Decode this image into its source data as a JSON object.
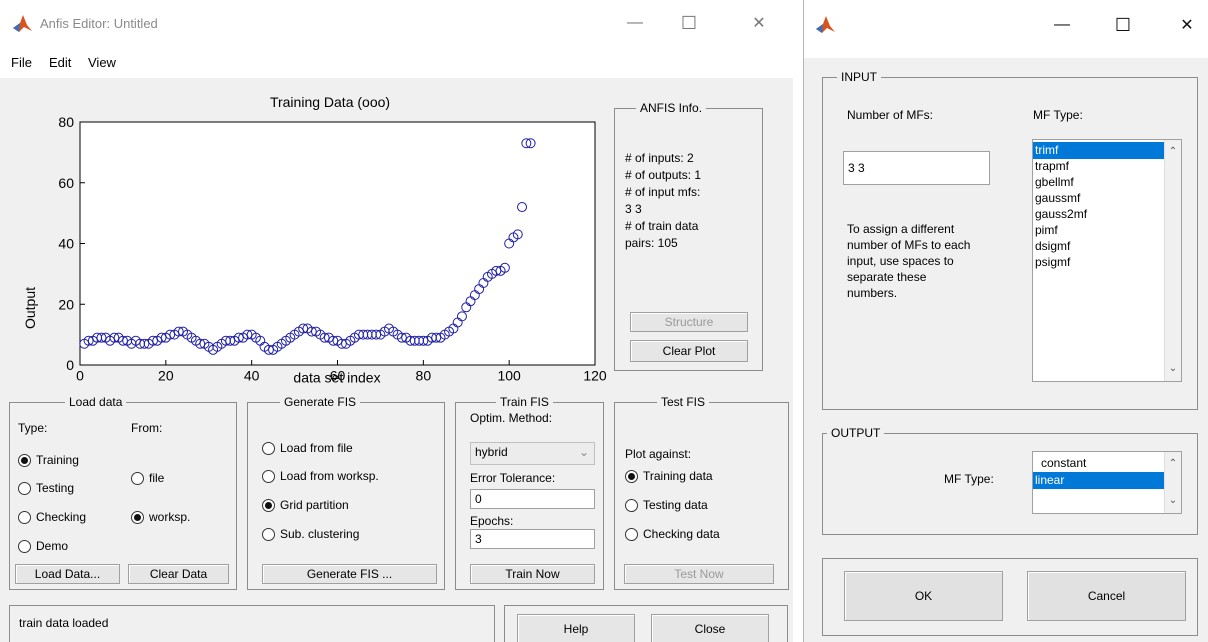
{
  "anfis": {
    "title": "Anfis Editor: Untitled",
    "menu": [
      "File",
      "Edit",
      "View"
    ],
    "plot": {
      "title": "Training Data (ooo)",
      "xlabel": "data set index",
      "ylabel": "Output",
      "xticks": [
        "0",
        "20",
        "40",
        "60",
        "80",
        "100",
        "120"
      ],
      "yticks": [
        "0",
        "20",
        "40",
        "60",
        "80"
      ]
    },
    "info": {
      "title": "ANFIS Info.",
      "lines": [
        "# of inputs: 2",
        "# of outputs: 1",
        "# of input mfs:",
        "3  3",
        "# of train data",
        "pairs: 105"
      ],
      "structure_label": "Structure",
      "clear_plot_label": "Clear Plot"
    },
    "load_data": {
      "title": "Load data",
      "type_label": "Type:",
      "from_label": "From:",
      "types": [
        "Training",
        "Testing",
        "Checking",
        "Demo"
      ],
      "selected_type": "Training",
      "sources": [
        "file",
        "worksp."
      ],
      "selected_source": "worksp.",
      "load_button": "Load Data...",
      "clear_button": "Clear Data"
    },
    "generate_fis": {
      "title": "Generate FIS",
      "options": [
        "Load from file",
        "Load from worksp.",
        "Grid partition",
        "Sub. clustering"
      ],
      "selected": "Grid partition",
      "button": "Generate FIS ..."
    },
    "train_fis": {
      "title": "Train FIS",
      "method_label": "Optim. Method:",
      "method": "hybrid",
      "tolerance_label": "Error Tolerance:",
      "tolerance": "0",
      "epochs_label": "Epochs:",
      "epochs": "3",
      "button": "Train Now"
    },
    "test_fis": {
      "title": "Test FIS",
      "plot_against_label": "Plot against:",
      "options": [
        "Training data",
        "Testing data",
        "Checking data"
      ],
      "selected": "Training data",
      "button": "Test Now"
    },
    "status": "train data loaded",
    "help_label": "Help",
    "close_label": "Close"
  },
  "mf_dialog": {
    "input": {
      "title": "INPUT",
      "num_label": "Number of MFs:",
      "num_value": "3 3",
      "type_label": "MF Type:",
      "hint": [
        "To assign a different",
        "number of MFs to each",
        "input, use spaces to",
        "separate these",
        "numbers."
      ],
      "types": [
        "trimf",
        "trapmf",
        "gbellmf",
        "gaussmf",
        "gauss2mf",
        "pimf",
        "dsigmf",
        "psigmf"
      ],
      "selected": "trimf"
    },
    "output": {
      "title": "OUTPUT",
      "type_label": "MF Type:",
      "types": [
        "constant",
        "linear"
      ],
      "selected": "linear"
    },
    "ok_label": "OK",
    "cancel_label": "Cancel"
  },
  "colors": {
    "marker": "#1f1fa6",
    "selection": "#0078d7",
    "window_bg": "#f0f0f0",
    "app_icon": "#d9531e"
  },
  "chart_data": {
    "type": "scatter",
    "title": "Training Data (ooo)",
    "xlabel": "data set index",
    "ylabel": "Output",
    "xlim": [
      0,
      120
    ],
    "ylim": [
      0,
      80
    ],
    "marker": "circle",
    "x": [
      1,
      2,
      3,
      4,
      5,
      6,
      7,
      8,
      9,
      10,
      11,
      12,
      13,
      14,
      15,
      16,
      17,
      18,
      19,
      20,
      21,
      22,
      23,
      24,
      25,
      26,
      27,
      28,
      29,
      30,
      31,
      32,
      33,
      34,
      35,
      36,
      37,
      38,
      39,
      40,
      41,
      42,
      43,
      44,
      45,
      46,
      47,
      48,
      49,
      50,
      51,
      52,
      53,
      54,
      55,
      56,
      57,
      58,
      59,
      60,
      61,
      62,
      63,
      64,
      65,
      66,
      67,
      68,
      69,
      70,
      71,
      72,
      73,
      74,
      75,
      76,
      77,
      78,
      79,
      80,
      81,
      82,
      83,
      84,
      85,
      86,
      87,
      88,
      89,
      90,
      91,
      92,
      93,
      94,
      95,
      96,
      97,
      98,
      99,
      100,
      101,
      102,
      103,
      104,
      105
    ],
    "y": [
      7,
      8,
      8,
      9,
      9,
      9,
      8,
      9,
      9,
      8,
      8,
      7,
      8,
      7,
      7,
      7,
      8,
      8,
      9,
      9,
      10,
      10,
      11,
      11,
      10,
      9,
      8,
      7,
      7,
      6,
      5,
      6,
      7,
      8,
      8,
      8,
      9,
      9,
      10,
      10,
      9,
      8,
      6,
      5,
      5,
      6,
      7,
      8,
      9,
      10,
      11,
      12,
      12,
      11,
      11,
      10,
      9,
      9,
      8,
      8,
      7,
      7,
      8,
      9,
      10,
      10,
      10,
      10,
      10,
      10,
      11,
      12,
      11,
      10,
      9,
      9,
      8,
      8,
      8,
      8,
      8,
      9,
      9,
      9,
      10,
      11,
      12,
      14,
      16,
      19,
      21,
      23,
      25,
      27,
      29,
      30,
      31,
      31,
      32,
      40,
      42,
      43,
      52,
      73,
      73
    ]
  }
}
